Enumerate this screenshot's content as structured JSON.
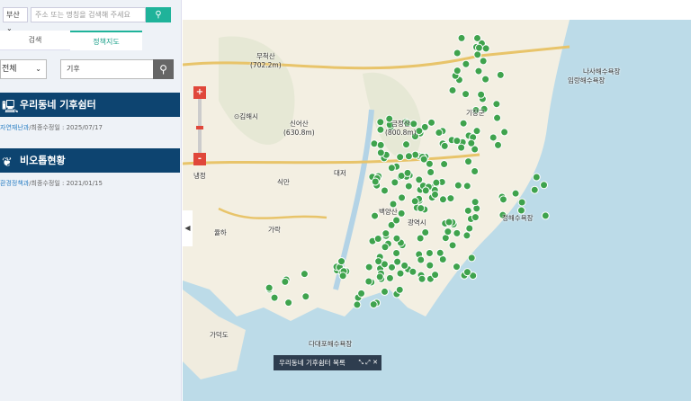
{
  "search": {
    "region": "부산",
    "placeholder": "주소 또는 명칭을 검색해 주세요"
  },
  "tabs": [
    {
      "label": "검색"
    },
    {
      "label": "정책지도"
    }
  ],
  "filter": {
    "category": "전체",
    "keyword": "기후"
  },
  "results": [
    {
      "title": "우리동네 기후쉼터",
      "dept": "자연재난과",
      "updated": "/최종수정일 : 2025/07/17",
      "icon": "shelter-icon"
    },
    {
      "title": "비오톱현황",
      "dept": "환경정책과",
      "updated": "/최종수정일 : 2021/01/15",
      "icon": "leaf-icon"
    }
  ],
  "map": {
    "labels": [
      {
        "t": "무척산",
        "s": "(702.2m)"
      },
      {
        "t": "⊙김해시"
      },
      {
        "t": "신어산",
        "s": "(630.8m)"
      },
      {
        "t": "금정산",
        "s": "(800.8m)"
      },
      {
        "t": "기장군"
      },
      {
        "t": "백양산"
      },
      {
        "t": "광역시"
      },
      {
        "t": "율하"
      },
      {
        "t": "가락"
      },
      {
        "t": "식만"
      },
      {
        "t": "대저"
      },
      {
        "t": "가덕도"
      },
      {
        "t": "다대포해수욕장"
      },
      {
        "t": "정해수욕장"
      },
      {
        "t": "임랑해수욕장"
      },
      {
        "t": "나사해수욕장"
      },
      {
        "t": "냉정"
      }
    ],
    "colors": {
      "land": "#f3efe2",
      "sea": "#bcdbe8",
      "marker": "#3fa34d",
      "road": "#e8c46a"
    },
    "list_bar": {
      "label": "우리동네 기후쉼터 목록"
    }
  }
}
